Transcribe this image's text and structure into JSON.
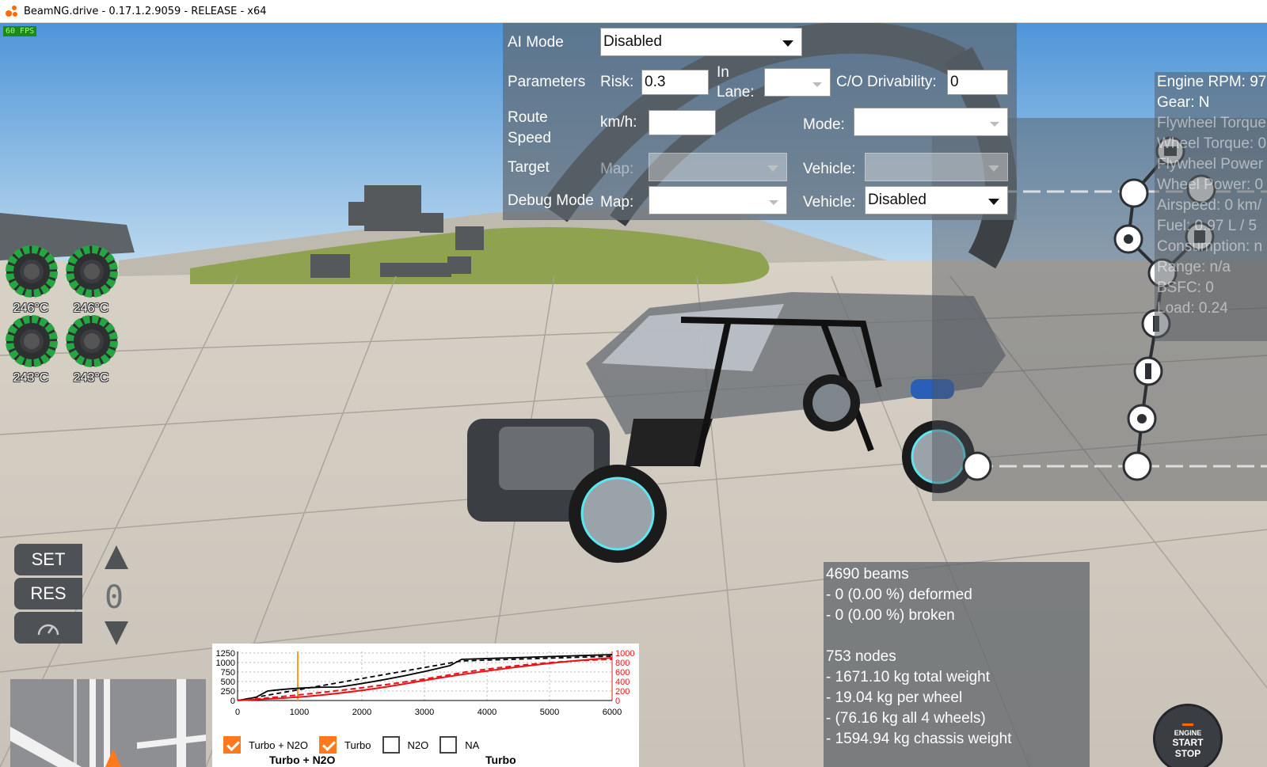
{
  "window": {
    "title": "BeamNG.drive - 0.17.1.2.9059 - RELEASE - x64"
  },
  "fps_badge": "60 FPS",
  "ai_panel": {
    "ai_mode_label": "AI Mode",
    "ai_mode_value": "Disabled",
    "parameters_label": "Parameters",
    "risk_label": "Risk:",
    "risk_value": "0.3",
    "in_lane_label_1": "In",
    "in_lane_label_2": "Lane:",
    "in_lane_value": "",
    "co_drivability_label": "C/O Drivability:",
    "co_drivability_value": "0",
    "route_speed_label_1": "Route",
    "route_speed_label_2": "Speed",
    "kmh_label": "km/h:",
    "kmh_value": "",
    "mode_label": "Mode:",
    "mode_value": "",
    "target_label": "Target",
    "target_map_label": "Map:",
    "target_vehicle_label": "Vehicle:",
    "debug_mode_label": "Debug Mode",
    "debug_map_label": "Map:",
    "debug_map_value": "",
    "debug_vehicle_label": "Vehicle:",
    "debug_vehicle_value": "Disabled"
  },
  "engine_info": [
    {
      "text": "Engine RPM: 97",
      "faded": false
    },
    {
      "text": "Gear: N",
      "faded": false
    },
    {
      "text": "Flywheel Torque",
      "faded": true
    },
    {
      "text": "Wheel Torque: 0",
      "faded": true
    },
    {
      "text": "Flywheel Power",
      "faded": true
    },
    {
      "text": "Wheel Power: 0",
      "faded": true
    },
    {
      "text": "Airspeed: 0 km/",
      "faded": true
    },
    {
      "text": "Fuel: 0.97 L / 5",
      "faded": true
    },
    {
      "text": "Consumption: n",
      "faded": true
    },
    {
      "text": "Range: n/a",
      "faded": true
    },
    {
      "text": "BSFC: 0",
      "faded": true
    },
    {
      "text": "Load: 0.24",
      "faded": true
    }
  ],
  "tire_temps": [
    "246°C",
    "246°C",
    "243°C",
    "243°C"
  ],
  "cruise": {
    "set_label": "SET",
    "res_label": "RES",
    "speed_display": "0"
  },
  "beams_info": [
    "4690 beams",
    "- 0 (0.00 %) deformed",
    "- 0 (0.00 %) broken",
    "",
    "753 nodes",
    "- 1671.10 kg total weight",
    "- 19.04 kg per wheel",
    "- (76.16 kg all 4 wheels)",
    "- 1594.94 kg chassis weight"
  ],
  "torque_graph": {
    "left_ticks": [
      "1250",
      "1000",
      "750",
      "500",
      "250",
      "0"
    ],
    "right_ticks": [
      "1000",
      "800",
      "600",
      "400",
      "200",
      "0"
    ],
    "x_ticks": [
      "0",
      "1000",
      "2000",
      "3000",
      "4000",
      "5000",
      "6000"
    ],
    "legend": [
      {
        "label": "Turbo + N2O",
        "checked": true
      },
      {
        "label": "Turbo",
        "checked": true
      },
      {
        "label": "N2O",
        "checked": false
      },
      {
        "label": "NA",
        "checked": false
      }
    ],
    "sub_left": "Turbo + N2O",
    "sub_right": "Turbo",
    "colors": {
      "torque": "#000000",
      "power": "#e8141a",
      "marker": "#ff9a1c"
    }
  },
  "engine_start": {
    "line1": "ENGINE",
    "line2": "START",
    "line3": "STOP"
  }
}
